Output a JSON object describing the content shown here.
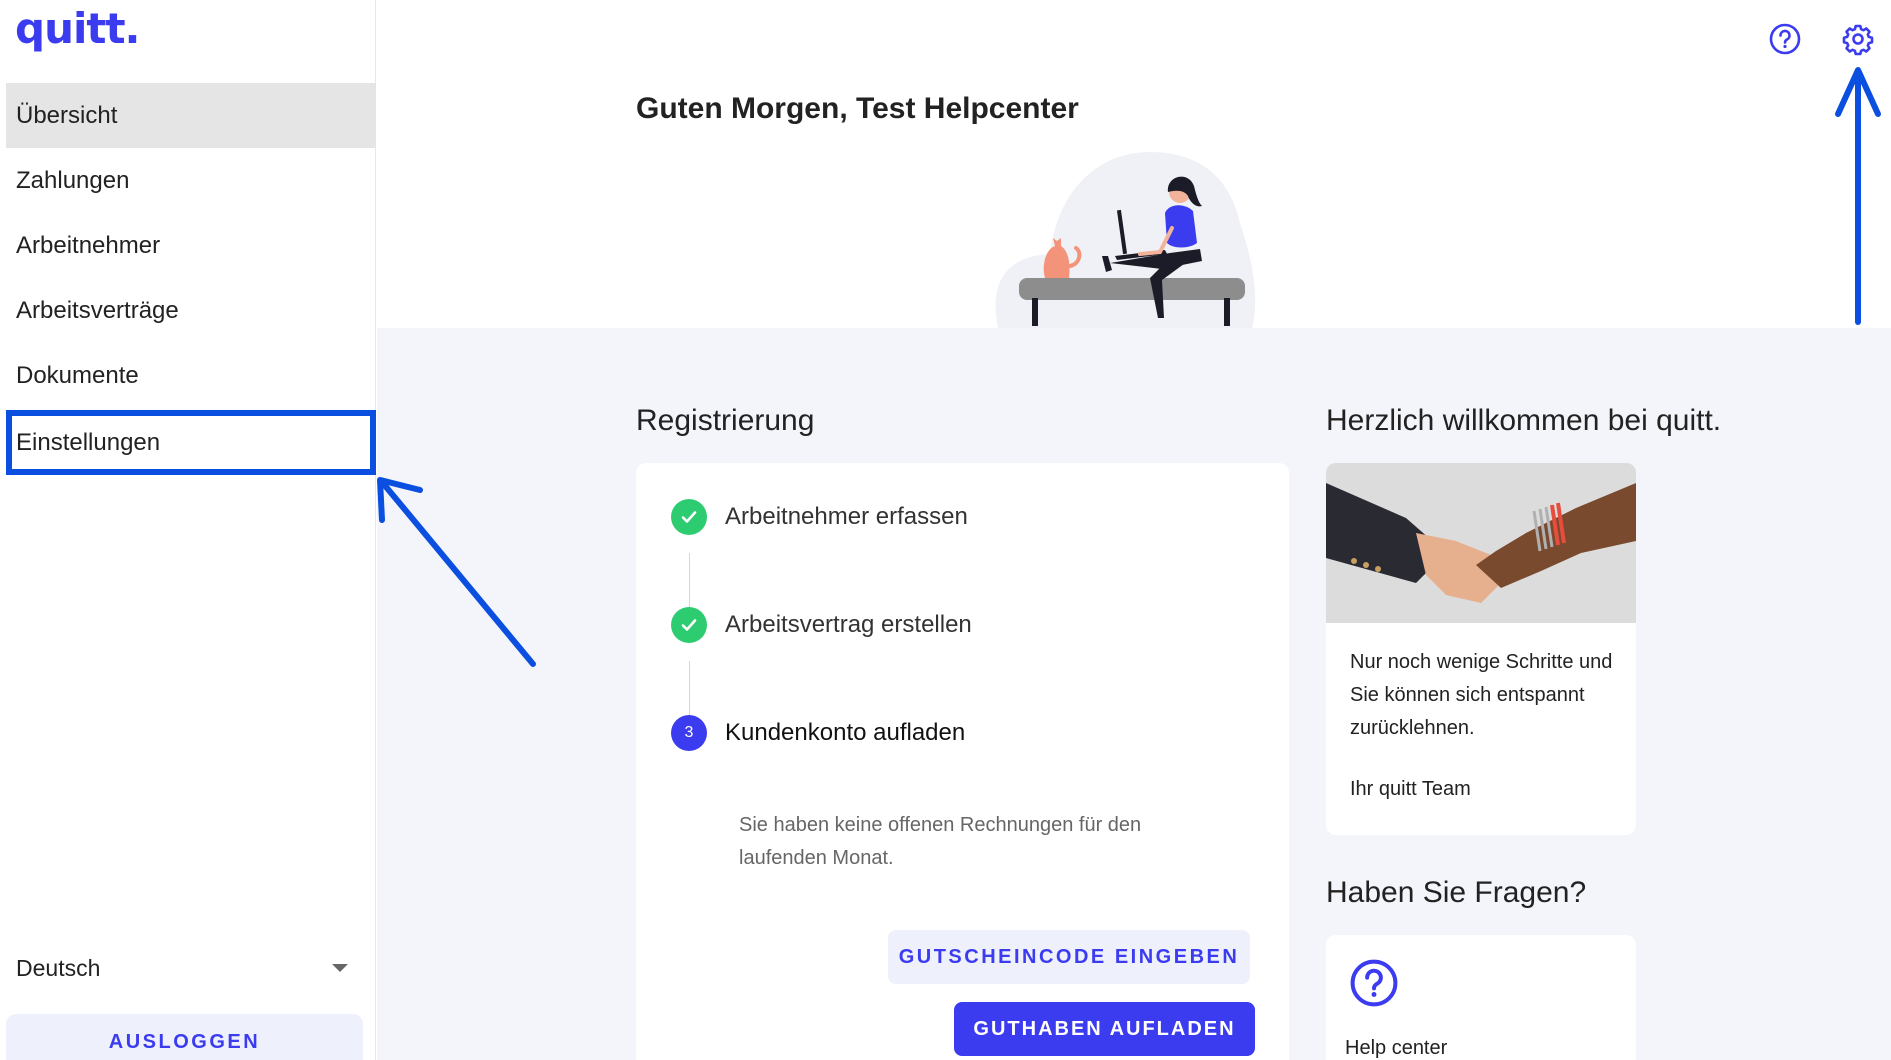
{
  "app": {
    "logo": "quitt."
  },
  "sidebar": {
    "items": [
      {
        "label": "Übersicht"
      },
      {
        "label": "Zahlungen"
      },
      {
        "label": "Arbeitnehmer"
      },
      {
        "label": "Arbeitsverträge"
      },
      {
        "label": "Dokumente"
      },
      {
        "label": "Einstellungen"
      }
    ],
    "language": "Deutsch",
    "logout_label": "AUSLOGGEN"
  },
  "header": {
    "greeting": "Guten Morgen, Test Helpcenter",
    "icons": [
      "help-circle-icon",
      "gear-icon"
    ]
  },
  "registration": {
    "title": "Registrierung",
    "steps": [
      {
        "label": "Arbeitnehmer erfassen",
        "status": "done"
      },
      {
        "label": "Arbeitsvertrag erstellen",
        "status": "done"
      },
      {
        "label": "Kundenkonto aufladen",
        "status": "current",
        "number": "3"
      }
    ],
    "info_text": "Sie haben keine offenen Rechnungen für den laufenden Monat.",
    "voucher_button": "GUTSCHEINCODE EINGEBEN",
    "topup_button": "GUTHABEN AUFLADEN"
  },
  "welcome": {
    "title": "Herzlich willkommen bei quitt.",
    "text": "Nur noch wenige Schritte und Sie können sich entspannt zurücklehnen.",
    "signature": "Ihr quitt Team"
  },
  "questions": {
    "title": "Haben Sie Fragen?",
    "help_label": "Help center"
  },
  "colors": {
    "brand": "#3b3bf0",
    "success": "#2ecc71",
    "annotation": "#0b4fe0",
    "background": "#f4f5fa",
    "active_nav": "#e5e5e5"
  }
}
